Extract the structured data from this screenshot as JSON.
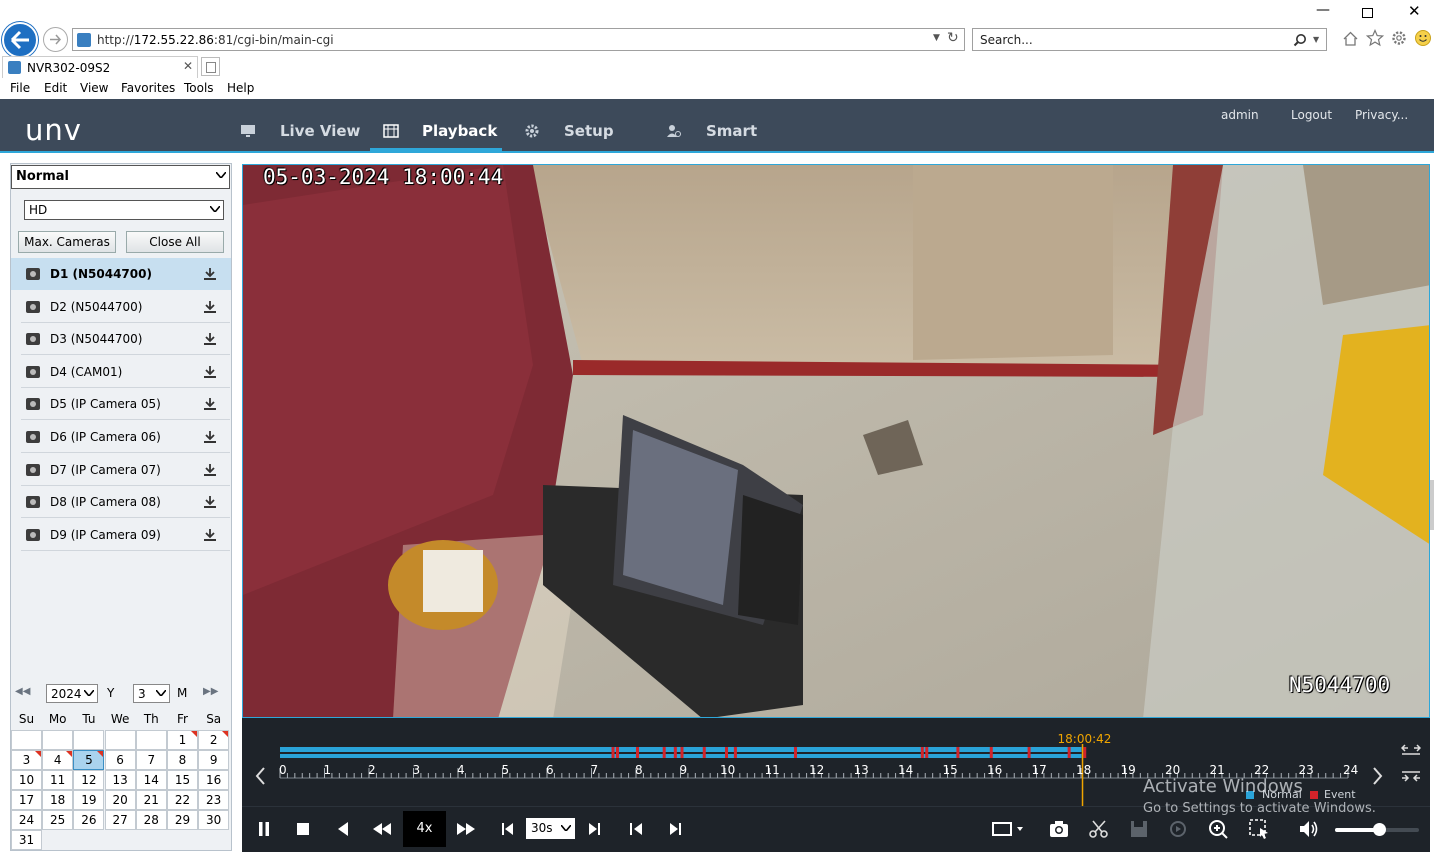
{
  "browser": {
    "url_prefix": "http://",
    "url_host": "172.55.22.86",
    "url_path": ":81/cgi-bin/main-cgi",
    "search_placeholder": "Search...",
    "tab_title": "NVR302-09S2",
    "menu": [
      "File",
      "Edit",
      "View",
      "Favorites",
      "Tools",
      "Help"
    ]
  },
  "app": {
    "logo": "unv",
    "nav": [
      "Live View",
      "Playback",
      "Setup",
      "Smart"
    ],
    "active_nav": "Playback",
    "user": "admin",
    "logout": "Logout",
    "privacy": "Privacy..."
  },
  "left": {
    "mode": "Normal",
    "stream": "HD",
    "max_cameras": "Max. Cameras",
    "close_all": "Close All",
    "cameras": [
      "D1 (N5044700)",
      "D2 (N5044700)",
      "D3 (N5044700)",
      "D4 (CAM01)",
      "D5 (IP Camera 05)",
      "D6 (IP Camera 06)",
      "D7 (IP Camera 07)",
      "D8 (IP Camera 08)",
      "D9 (IP Camera 09)"
    ],
    "selected_camera": 0
  },
  "calendar": {
    "year": "2024",
    "year_label": "Y",
    "month": "3",
    "month_label": "M",
    "weekdays": [
      "Su",
      "Mo",
      "Tu",
      "We",
      "Th",
      "Fr",
      "Sa"
    ],
    "days": [
      "",
      "",
      "",
      "",
      "",
      "1",
      "2",
      "3",
      "4",
      "5",
      "6",
      "7",
      "8",
      "9",
      "10",
      "11",
      "12",
      "13",
      "14",
      "15",
      "16",
      "17",
      "18",
      "19",
      "20",
      "21",
      "22",
      "23",
      "24",
      "25",
      "26",
      "27",
      "28",
      "29",
      "30",
      "31"
    ],
    "recorded_days": [
      "1",
      "2",
      "3",
      "4",
      "5"
    ],
    "selected_day": "5"
  },
  "video": {
    "timestamp": "05-03-2024 18:00:44",
    "camera_name": "N5044700"
  },
  "timeline": {
    "cursor_time": "18:00:42",
    "hours": [
      "0",
      "1",
      "2",
      "3",
      "4",
      "5",
      "6",
      "7",
      "8",
      "9",
      "10",
      "11",
      "12",
      "13",
      "14",
      "15",
      "16",
      "17",
      "18",
      "19",
      "20",
      "21",
      "22",
      "23",
      "24"
    ],
    "normal_color": "#2aa3d8",
    "event_color": "#d2232a",
    "legend_normal": "Normal",
    "legend_event": "Event"
  },
  "controls": {
    "speed": "4x",
    "interval": "30s"
  },
  "watermark": {
    "line1": "Activate Windows",
    "line2": "Go to Settings to activate Windows."
  }
}
